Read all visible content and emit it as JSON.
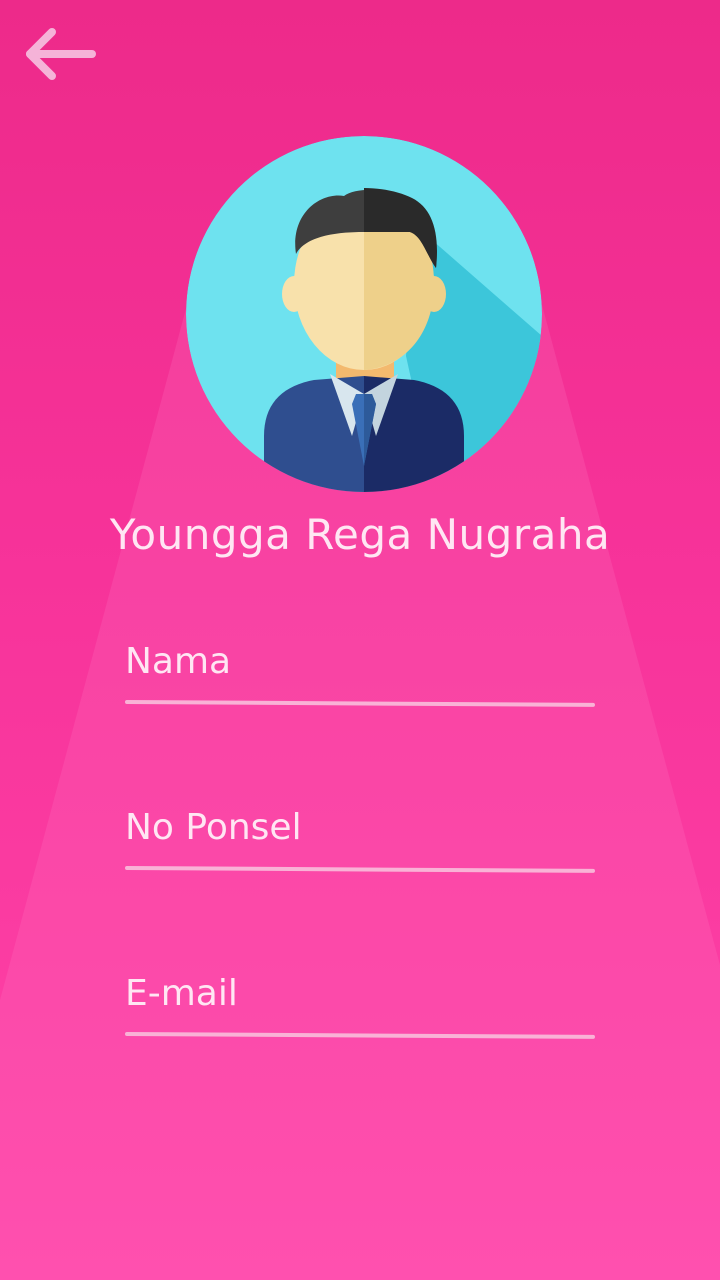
{
  "header": {
    "back_icon": "arrow-left-icon"
  },
  "profile": {
    "avatar_icon": "businessman-avatar-icon",
    "name": "Youngga Rega Nugraha"
  },
  "form": {
    "fields": [
      {
        "placeholder": "Nama",
        "value": ""
      },
      {
        "placeholder": "No Ponsel",
        "value": ""
      },
      {
        "placeholder": "E-mail",
        "value": ""
      }
    ]
  },
  "colors": {
    "background_top": "#ED2A8A",
    "background_bottom": "#FF44A9",
    "text": "#FFE6F3",
    "underline": "#F9B2D6",
    "avatar_bg": "#6EE2EF"
  }
}
